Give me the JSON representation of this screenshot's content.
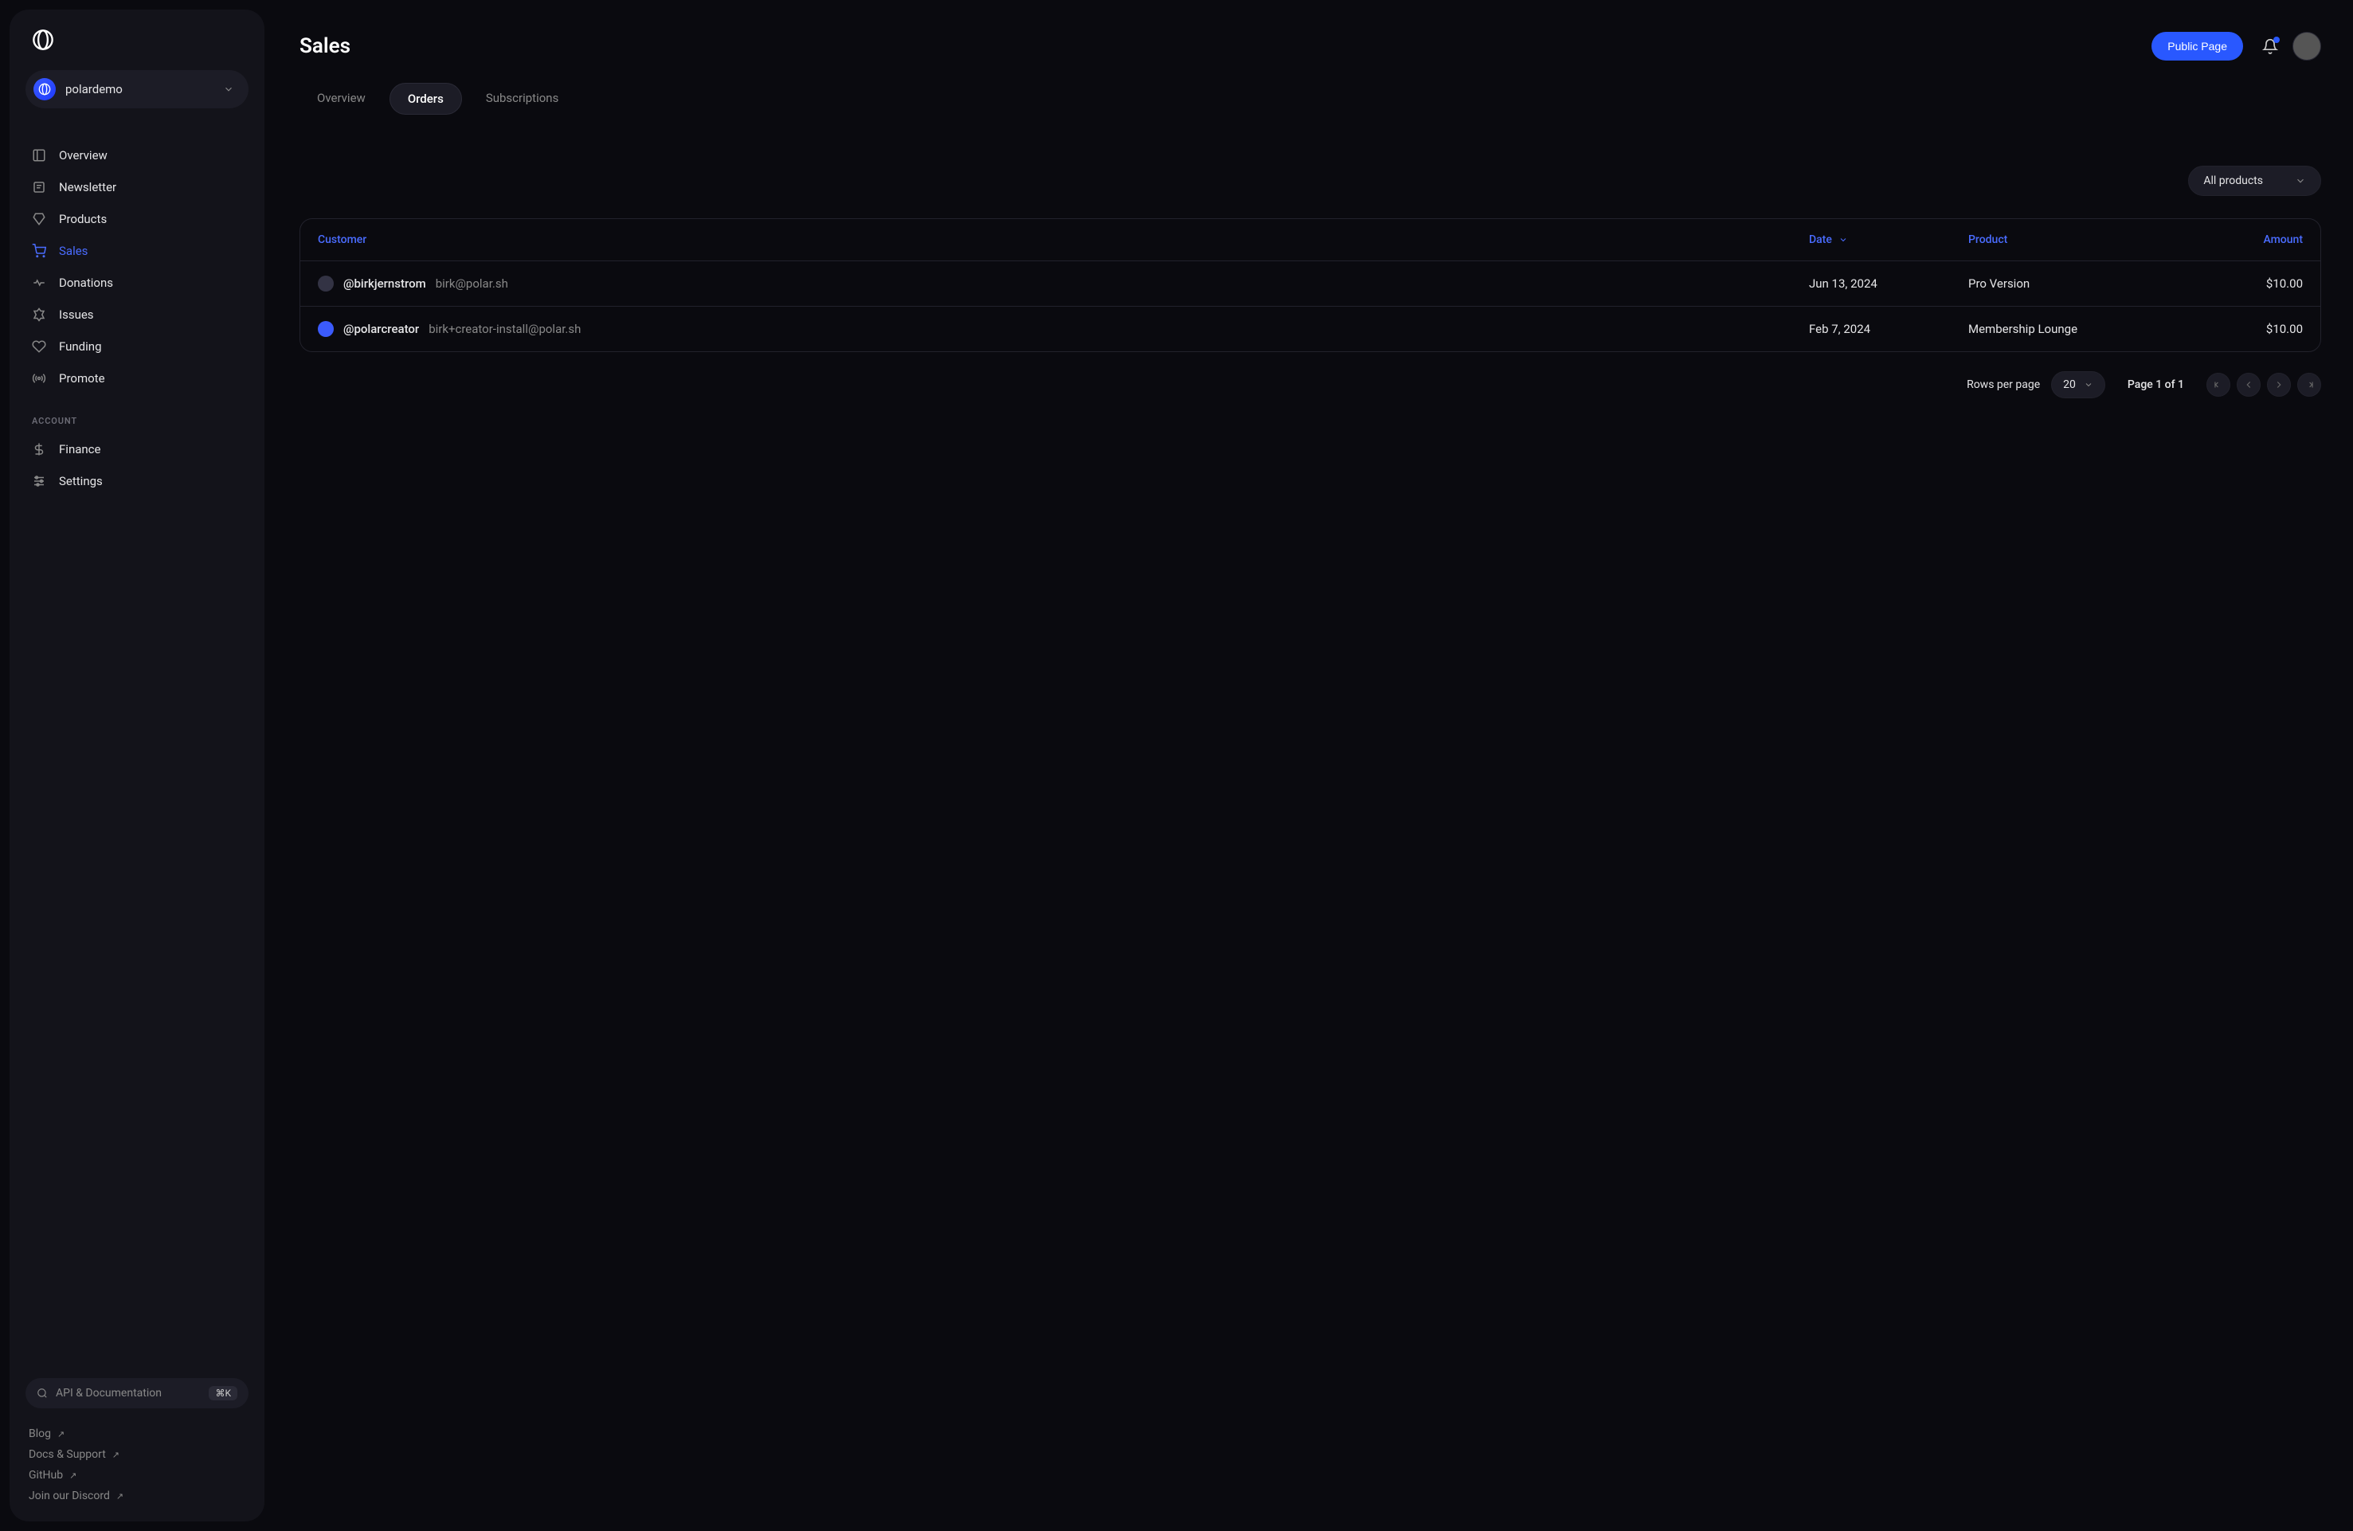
{
  "org": {
    "name": "polardemo"
  },
  "sidebar": {
    "items": [
      {
        "label": "Overview"
      },
      {
        "label": "Newsletter"
      },
      {
        "label": "Products"
      },
      {
        "label": "Sales"
      },
      {
        "label": "Donations"
      },
      {
        "label": "Issues"
      },
      {
        "label": "Funding"
      },
      {
        "label": "Promote"
      }
    ],
    "account_label": "ACCOUNT",
    "account_items": [
      {
        "label": "Finance"
      },
      {
        "label": "Settings"
      }
    ],
    "search_placeholder": "API & Documentation",
    "search_kbd": "⌘K",
    "footer": [
      {
        "label": "Blog"
      },
      {
        "label": "Docs & Support"
      },
      {
        "label": "GitHub"
      },
      {
        "label": "Join our Discord"
      }
    ]
  },
  "header": {
    "title": "Sales",
    "public_page": "Public Page"
  },
  "tabs": [
    {
      "label": "Overview"
    },
    {
      "label": "Orders"
    },
    {
      "label": "Subscriptions"
    }
  ],
  "filter": {
    "label": "All products"
  },
  "table": {
    "columns": {
      "customer": "Customer",
      "date": "Date",
      "product": "Product",
      "amount": "Amount"
    },
    "rows": [
      {
        "handle": "@birkjernstrom",
        "email": "birk@polar.sh",
        "date": "Jun 13, 2024",
        "product": "Pro Version",
        "amount": "$10.00"
      },
      {
        "handle": "@polarcreator",
        "email": "birk+creator-install@polar.sh",
        "date": "Feb 7, 2024",
        "product": "Membership Lounge",
        "amount": "$10.00"
      }
    ]
  },
  "pagination": {
    "rows_per_page_label": "Rows per page",
    "rows_per_page_value": "20",
    "page_info": "Page 1 of 1"
  }
}
